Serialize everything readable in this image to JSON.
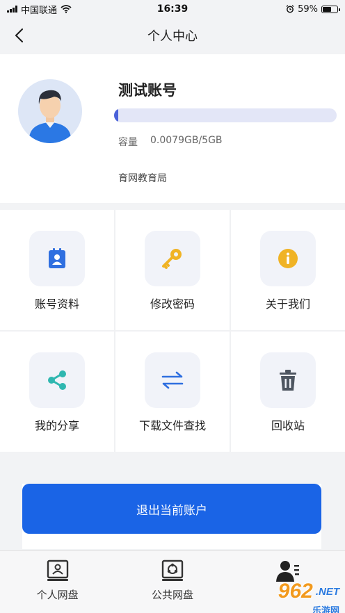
{
  "status_bar": {
    "carrier": "中国联通",
    "time": "16:39",
    "battery": "59%",
    "battery_level": 0.59
  },
  "nav": {
    "title": "个人中心"
  },
  "profile": {
    "account_name": "测试账号",
    "storage_used_fraction": 0.0016,
    "capacity_label": "容量",
    "capacity_value": "0.0079GB/5GB",
    "organization": "育网教育局"
  },
  "grid": {
    "items": [
      {
        "label": "账号资料",
        "icon": "contact-card-icon",
        "color": "#2f6fe0"
      },
      {
        "label": "修改密码",
        "icon": "key-icon",
        "color": "#f0b325"
      },
      {
        "label": "关于我们",
        "icon": "info-icon",
        "color": "#f0b325"
      },
      {
        "label": "我的分享",
        "icon": "share-icon",
        "color": "#2fb7b0"
      },
      {
        "label": "下载文件查找",
        "icon": "transfer-arrows-icon",
        "color": "#2f6fe0"
      },
      {
        "label": "回收站",
        "icon": "trash-icon",
        "color": "#4d5560"
      }
    ]
  },
  "logout": {
    "label": "退出当前账户"
  },
  "tabs": [
    {
      "label": "个人网盘",
      "icon": "personal-drive-icon"
    },
    {
      "label": "公共网盘",
      "icon": "public-drive-icon"
    },
    {
      "label": "",
      "icon": "profile-icon"
    }
  ],
  "watermark": {
    "main": "962",
    "suffix": ".NET",
    "sub": "乐游网"
  }
}
